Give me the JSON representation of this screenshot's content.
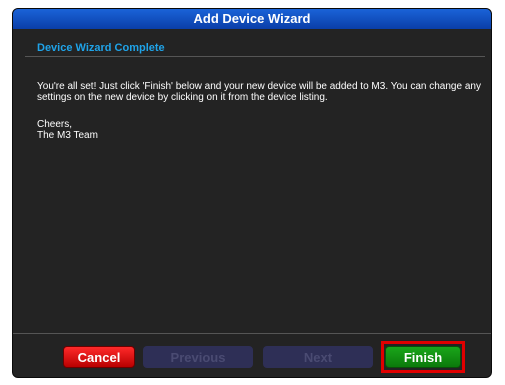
{
  "dialog": {
    "title": "Add Device Wizard",
    "section": "Device Wizard Complete",
    "message": "You're all set! Just click 'Finish' below and your new device will be added to M3. You can change any settings on the new device by clicking on it from the device listing.",
    "closing": "Cheers,",
    "signature": "The M3 Team"
  },
  "buttons": {
    "cancel": "Cancel",
    "previous": "Previous",
    "next": "Next",
    "finish": "Finish"
  },
  "colors": {
    "accent": "#1fa3e8",
    "cancel": "#d10000",
    "finish": "#129a12",
    "disabled": "#2e2f56"
  }
}
